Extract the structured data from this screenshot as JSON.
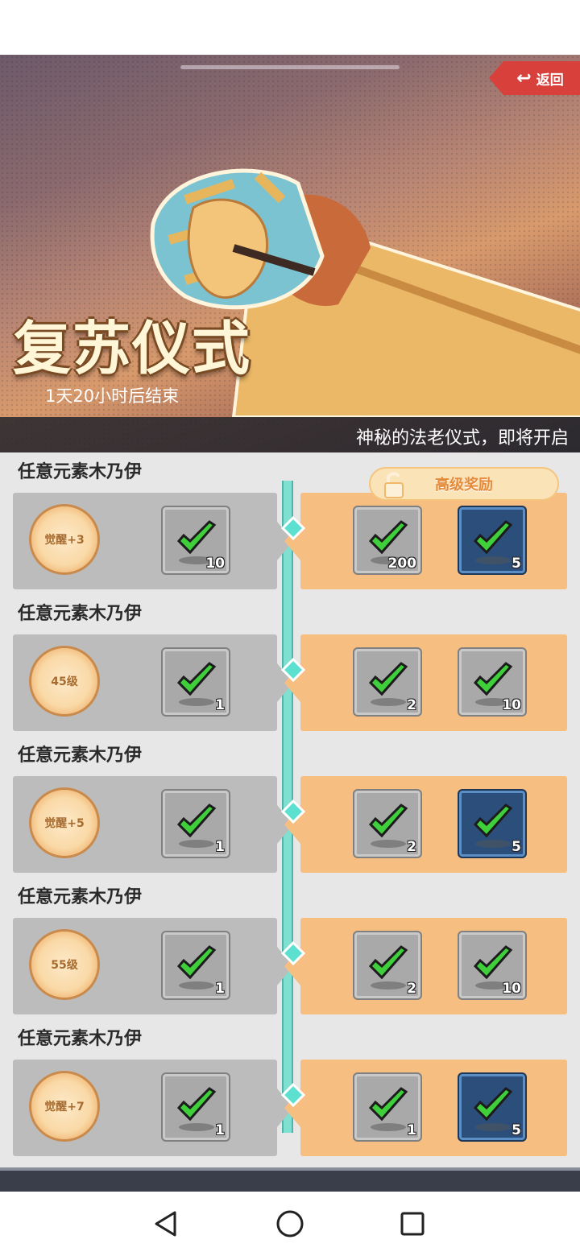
{
  "header": {
    "back_label": "返回",
    "title": "复苏仪式",
    "countdown": "1天20小时后结束",
    "subtitle": "神秘的法老仪式，即将开启"
  },
  "premium": {
    "label": "高级奖励"
  },
  "tasks": [
    {
      "title": "任意元素木乃伊",
      "milestone": "觉醒+3",
      "free_count": "10",
      "paid": [
        {
          "count": "200",
          "rare": false
        },
        {
          "count": "5",
          "rare": true
        }
      ]
    },
    {
      "title": "任意元素木乃伊",
      "milestone": "45级",
      "free_count": "1",
      "paid": [
        {
          "count": "2",
          "rare": false
        },
        {
          "count": "10",
          "rare": false
        }
      ]
    },
    {
      "title": "任意元素木乃伊",
      "milestone": "觉醒+5",
      "free_count": "1",
      "paid": [
        {
          "count": "2",
          "rare": false
        },
        {
          "count": "5",
          "rare": true
        }
      ]
    },
    {
      "title": "任意元素木乃伊",
      "milestone": "55级",
      "free_count": "1",
      "paid": [
        {
          "count": "2",
          "rare": false
        },
        {
          "count": "10",
          "rare": false
        }
      ]
    },
    {
      "title": "任意元素木乃伊",
      "milestone": "觉醒+7",
      "free_count": "1",
      "paid": [
        {
          "count": "1",
          "rare": false
        },
        {
          "count": "5",
          "rare": true
        }
      ]
    }
  ],
  "icons": {
    "back": "return-arrow-icon",
    "lock": "unlocked-padlock-icon",
    "claimed": "green-checkmark-icon",
    "nav": [
      "back-triangle-icon",
      "home-circle-icon",
      "recents-square-icon"
    ]
  },
  "colors": {
    "back_button": "#d8403c",
    "free_panel": "#bcbcbc",
    "paid_panel": "#f7be82",
    "timeline": "#7fe0d2",
    "check": "#3ecf3a"
  }
}
